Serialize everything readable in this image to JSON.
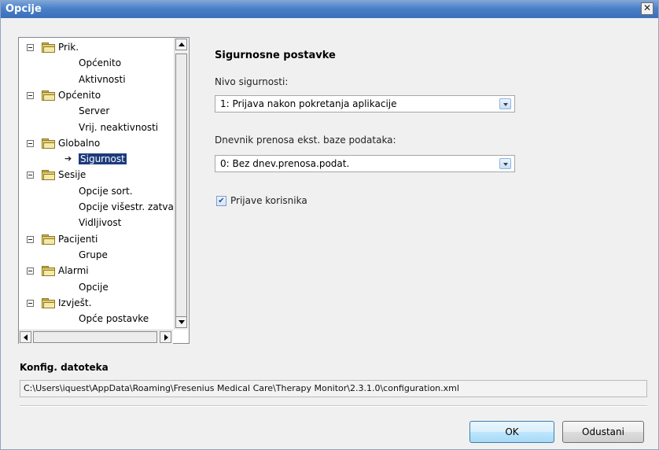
{
  "window": {
    "title": "Opcije",
    "close_glyph": "✕"
  },
  "tree": {
    "nodes": [
      {
        "label": "Prik.",
        "type": "folder"
      },
      {
        "label": "Općenito",
        "type": "leaf"
      },
      {
        "label": "Aktivnosti",
        "type": "leaf"
      },
      {
        "label": "Općenito",
        "type": "folder"
      },
      {
        "label": "Server",
        "type": "leaf"
      },
      {
        "label": "Vrij. neaktivnosti",
        "type": "leaf"
      },
      {
        "label": "Globalno",
        "type": "folder"
      },
      {
        "label": "Sigurnost",
        "type": "leaf",
        "selected": true
      },
      {
        "label": "Sesije",
        "type": "folder"
      },
      {
        "label": "Opcije sort.",
        "type": "leaf"
      },
      {
        "label": "Opcije višestr. zatva",
        "type": "leaf"
      },
      {
        "label": "Vidljivost",
        "type": "leaf"
      },
      {
        "label": "Pacijenti",
        "type": "folder"
      },
      {
        "label": "Grupe",
        "type": "leaf"
      },
      {
        "label": "Alarmi",
        "type": "folder"
      },
      {
        "label": "Opcije",
        "type": "leaf"
      },
      {
        "label": "Izvješt.",
        "type": "folder"
      },
      {
        "label": "Opće postavke",
        "type": "leaf"
      }
    ]
  },
  "settings": {
    "title": "Sigurnosne postavke",
    "security_level_label": "Nivo sigurnosti:",
    "security_level_value": "1: Prijava nakon pokretanja aplikacije",
    "log_label": "Dnevnik prenosa ekst. baze podataka:",
    "log_value": "0: Bez dnev.prenosa.podat.",
    "user_logins_label": "Prijave korisnika",
    "user_logins_checked": true,
    "check_glyph": "✔"
  },
  "config": {
    "title": "Konfig. datoteka",
    "path": "C:\\Users\\iquest\\AppData\\Roaming\\Fresenius Medical Care\\Therapy Monitor\\2.3.1.0\\configuration.xml"
  },
  "buttons": {
    "ok": "OK",
    "cancel": "Odustani"
  }
}
